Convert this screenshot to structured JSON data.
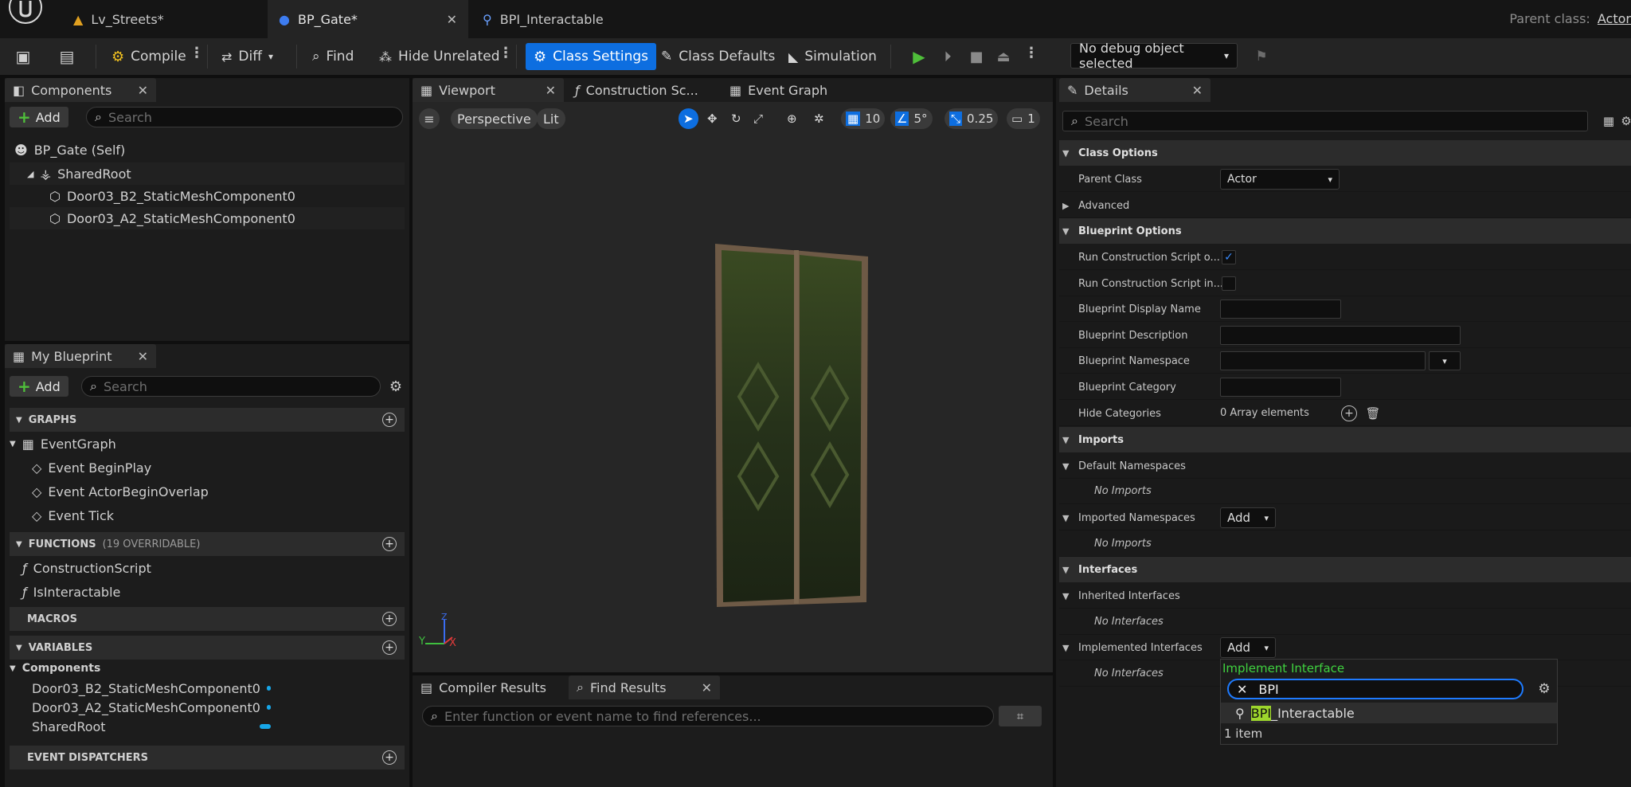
{
  "tabs": [
    {
      "label": "Lv_Streets*"
    },
    {
      "label": "BP_Gate*"
    },
    {
      "label": "BPI_Interactable"
    }
  ],
  "parent_class": {
    "label": "Parent class:",
    "value": "Actor"
  },
  "toolbar": {
    "compile": "Compile",
    "diff": "Diff",
    "find": "Find",
    "hide_unrelated": "Hide Unrelated",
    "class_settings": "Class Settings",
    "class_defaults": "Class Defaults",
    "simulation": "Simulation",
    "debug_object": "No debug object selected"
  },
  "components": {
    "title": "Components",
    "add": "Add",
    "search_placeholder": "Search",
    "items": [
      {
        "label": "BP_Gate (Self)"
      },
      {
        "label": "SharedRoot"
      },
      {
        "label": "Door03_B2_StaticMeshComponent0"
      },
      {
        "label": "Door03_A2_StaticMeshComponent0"
      }
    ]
  },
  "my_blueprint": {
    "title": "My Blueprint",
    "add": "Add",
    "search_placeholder": "Search",
    "graphs": "GRAPHS",
    "event_graph": "EventGraph",
    "events": [
      "Event BeginPlay",
      "Event ActorBeginOverlap",
      "Event Tick"
    ],
    "functions": "FUNCTIONS",
    "functions_note": "(19 OVERRIDABLE)",
    "function_items": [
      "ConstructionScript",
      "IsInteractable"
    ],
    "macros": "MACROS",
    "variables": "VARIABLES",
    "components_cat": "Components",
    "variable_items": [
      "Door03_B2_StaticMeshComponent0",
      "Door03_A2_StaticMeshComponent0",
      "SharedRoot"
    ],
    "event_dispatchers": "EVENT DISPATCHERS"
  },
  "viewport_tabs": [
    "Viewport",
    "Construction Sc...",
    "Event Graph"
  ],
  "viewport_bar": {
    "perspective": "Perspective",
    "lit": "Lit",
    "grid": "10",
    "angle": "5°",
    "scale": "0.25",
    "camera": "1"
  },
  "axes": {
    "y": "Y",
    "x": "X",
    "z": "Z"
  },
  "bottom": {
    "compiler_results": "Compiler Results",
    "find_results": "Find Results",
    "find_placeholder": "Enter function or event name to find references..."
  },
  "details": {
    "title": "Details",
    "search_placeholder": "Search",
    "class_options": "Class Options",
    "parent_class_label": "Parent Class",
    "parent_class_value": "Actor",
    "advanced": "Advanced",
    "blueprint_options": "Blueprint Options",
    "run_cs_ok": "Run Construction Script o...",
    "run_cs_in": "Run Construction Script in...",
    "display_name": "Blueprint Display Name",
    "description": "Blueprint Description",
    "namespace": "Blueprint Namespace",
    "category": "Blueprint Category",
    "hide_categories": "Hide Categories",
    "array_elements": "0 Array elements",
    "imports": "Imports",
    "default_namespaces": "Default Namespaces",
    "no_imports": "No Imports",
    "imported_namespaces": "Imported Namespaces",
    "add": "Add",
    "interfaces": "Interfaces",
    "inherited_interfaces": "Inherited Interfaces",
    "no_interfaces": "No Interfaces",
    "implemented_interfaces": "Implemented Interfaces"
  },
  "popup": {
    "title": "Implement Interface",
    "search_value": "BPI",
    "result_match": "BPI",
    "result_rest": "_Interactable",
    "count": "1 item"
  },
  "colors": {
    "accent": "#0d6ee0",
    "play": "#4fbf3a",
    "highlight": "#9dd62c"
  }
}
